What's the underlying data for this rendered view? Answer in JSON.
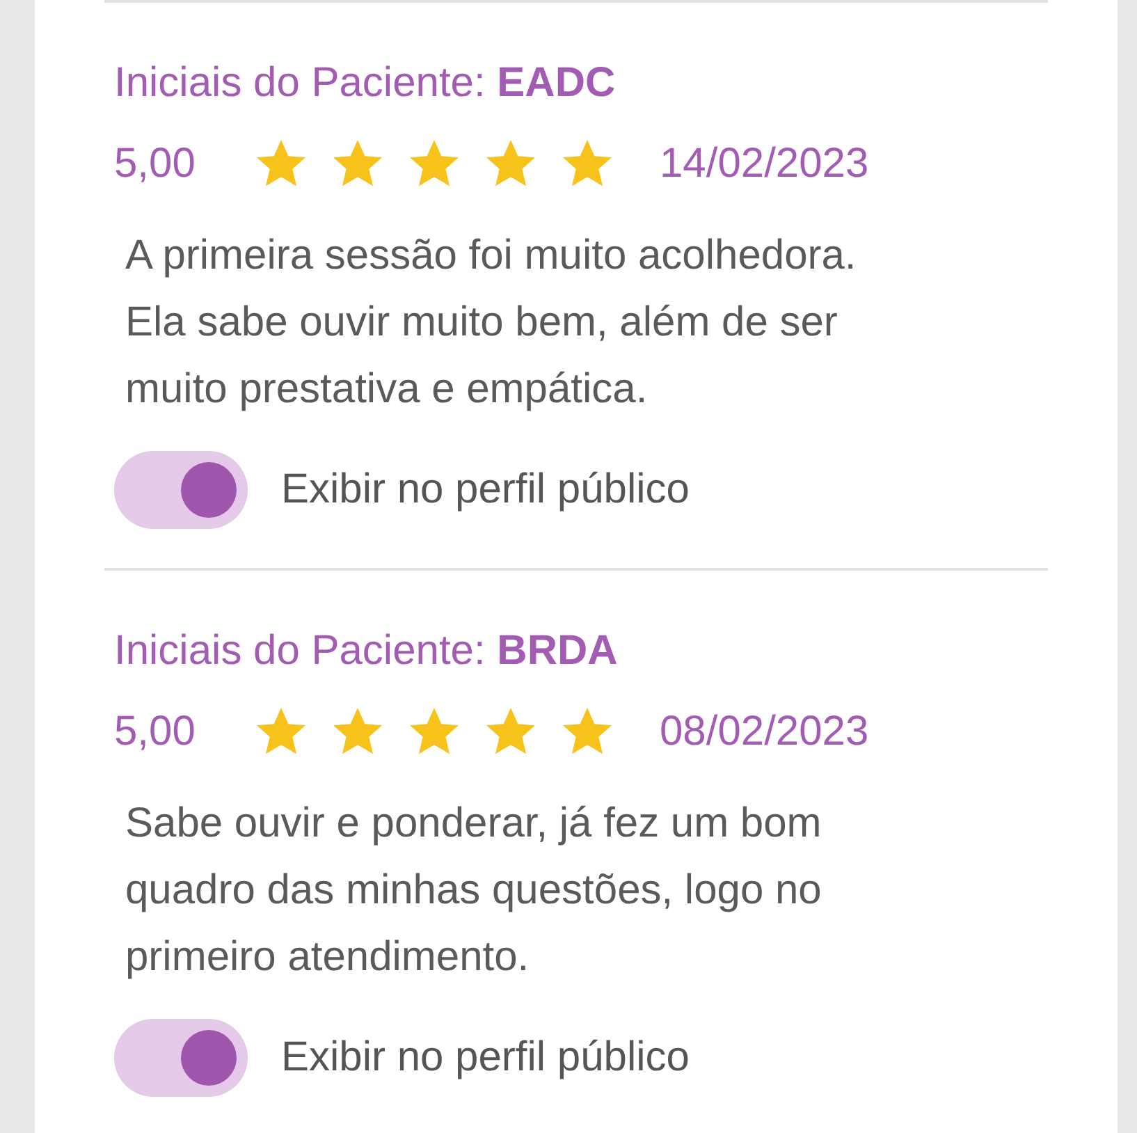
{
  "reviews": [
    {
      "initials_label": "Iniciais do Paciente:",
      "initials": "EADC",
      "rating": "5,00",
      "stars": 5,
      "date": "14/02/2023",
      "text": "A primeira sessão foi muito acolhedora. Ela sabe ouvir muito bem, além de ser muito prestativa e empática.",
      "toggle": {
        "label": "Exibir no perfil público",
        "on": true
      }
    },
    {
      "initials_label": "Iniciais do Paciente:",
      "initials": "BRDA",
      "rating": "5,00",
      "stars": 5,
      "date": "08/02/2023",
      "text": "Sabe ouvir e ponderar, já fez um bom quadro das minhas questões, logo no primeiro atendimento.",
      "toggle": {
        "label": "Exibir no perfil público",
        "on": true
      }
    }
  ]
}
